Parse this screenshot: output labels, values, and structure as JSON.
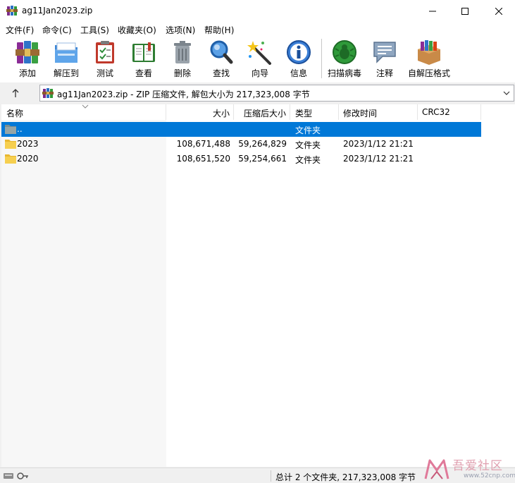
{
  "window": {
    "title": "ag11Jan2023.zip",
    "app_icon": "winrar-books-icon"
  },
  "menu": [
    "文件(F)",
    "命令(C)",
    "工具(S)",
    "收藏夹(O)",
    "选项(N)",
    "帮助(H)"
  ],
  "toolbar": {
    "buttons": [
      {
        "label": "添加",
        "icon": "add-archive-icon"
      },
      {
        "label": "解压到",
        "icon": "extract-folder-icon"
      },
      {
        "label": "测试",
        "icon": "test-clipboard-icon"
      },
      {
        "label": "查看",
        "icon": "view-book-icon"
      },
      {
        "label": "删除",
        "icon": "trash-can-icon"
      },
      {
        "label": "查找",
        "icon": "find-magnifier-icon"
      },
      {
        "label": "向导",
        "icon": "wizard-wand-icon"
      },
      {
        "label": "信息",
        "icon": "info-icon"
      },
      {
        "label": "扫描病毒",
        "icon": "virus-scan-icon"
      },
      {
        "label": "注释",
        "icon": "comment-icon"
      },
      {
        "label": "自解压格式",
        "icon": "sfx-box-icon"
      }
    ]
  },
  "address": {
    "text": "ag11Jan2023.zip - ZIP 压缩文件, 解包大小为 217,323,008 字节"
  },
  "columns": {
    "name": "名称",
    "size": "大小",
    "packed": "压缩后大小",
    "type": "类型",
    "modified": "修改时间",
    "crc": "CRC32"
  },
  "rows": [
    {
      "name": "..",
      "size": "",
      "packed": "",
      "type": "文件夹",
      "modified": "",
      "crc": "",
      "selected": true
    },
    {
      "name": "2023",
      "size": "108,671,488",
      "packed": "59,264,829",
      "type": "文件夹",
      "modified": "2023/1/12 21:21",
      "crc": "",
      "selected": false
    },
    {
      "name": "2020",
      "size": "108,651,520",
      "packed": "59,254,661",
      "type": "文件夹",
      "modified": "2023/1/12 21:21",
      "crc": "",
      "selected": false
    }
  ],
  "status": {
    "text": "总计 2 个文件夹, 217,323,008 字节"
  },
  "watermark": {
    "text": "吾爱社区",
    "url": "www.52cnp.com"
  },
  "colors": {
    "selection": "#0078d7",
    "window_bg": "#f0f0f0"
  }
}
